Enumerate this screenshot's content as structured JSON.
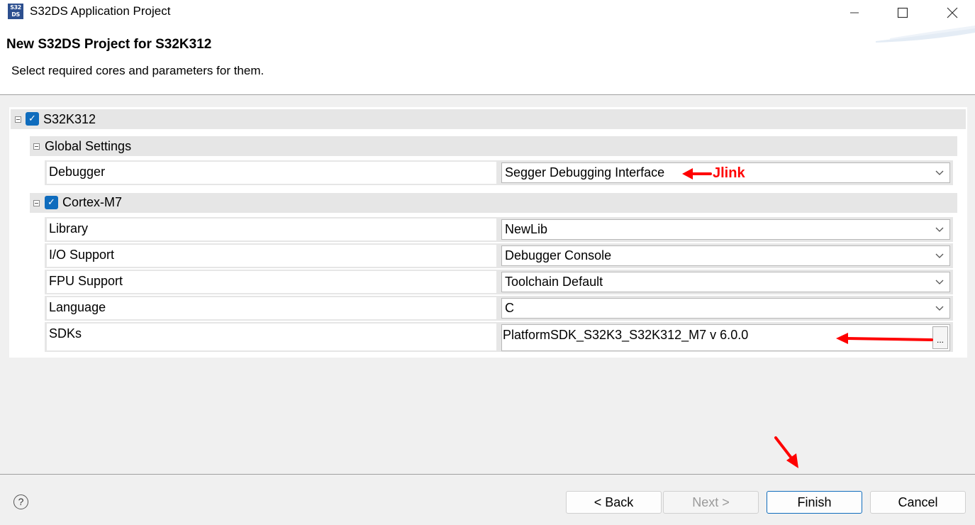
{
  "window": {
    "title": "S32DS Application Project",
    "icon_text": "S32 DS",
    "controls": [
      "minimize",
      "maximize",
      "close"
    ]
  },
  "header": {
    "title": "New S32DS Project for S32K312",
    "description": "Select required cores and parameters for them."
  },
  "tree": {
    "root": {
      "label": "S32K312",
      "checked": true,
      "expanded": true
    },
    "global_settings": {
      "label": "Global Settings",
      "expanded": true,
      "properties": [
        {
          "label": "Debugger",
          "value": "Segger Debugging Interface",
          "control": "dropdown"
        }
      ]
    },
    "core": {
      "label": "Cortex-M7",
      "checked": true,
      "expanded": true,
      "properties": [
        {
          "label": "Library",
          "value": "NewLib",
          "control": "dropdown"
        },
        {
          "label": "I/O Support",
          "value": "Debugger Console",
          "control": "dropdown"
        },
        {
          "label": "FPU Support",
          "value": "Toolchain Default",
          "control": "dropdown"
        },
        {
          "label": "Language",
          "value": "C",
          "control": "dropdown"
        },
        {
          "label": "SDKs",
          "value": "PlatformSDK_S32K3_S32K312_M7 v 6.0.0",
          "control": "browse",
          "browse_label": "..."
        }
      ]
    }
  },
  "annotations": {
    "jlink_label": "Jlink",
    "color": "#ff0000"
  },
  "footer": {
    "help_label": "?",
    "buttons": {
      "back": "< Back",
      "next": "Next >",
      "finish": "Finish",
      "cancel": "Cancel"
    }
  }
}
